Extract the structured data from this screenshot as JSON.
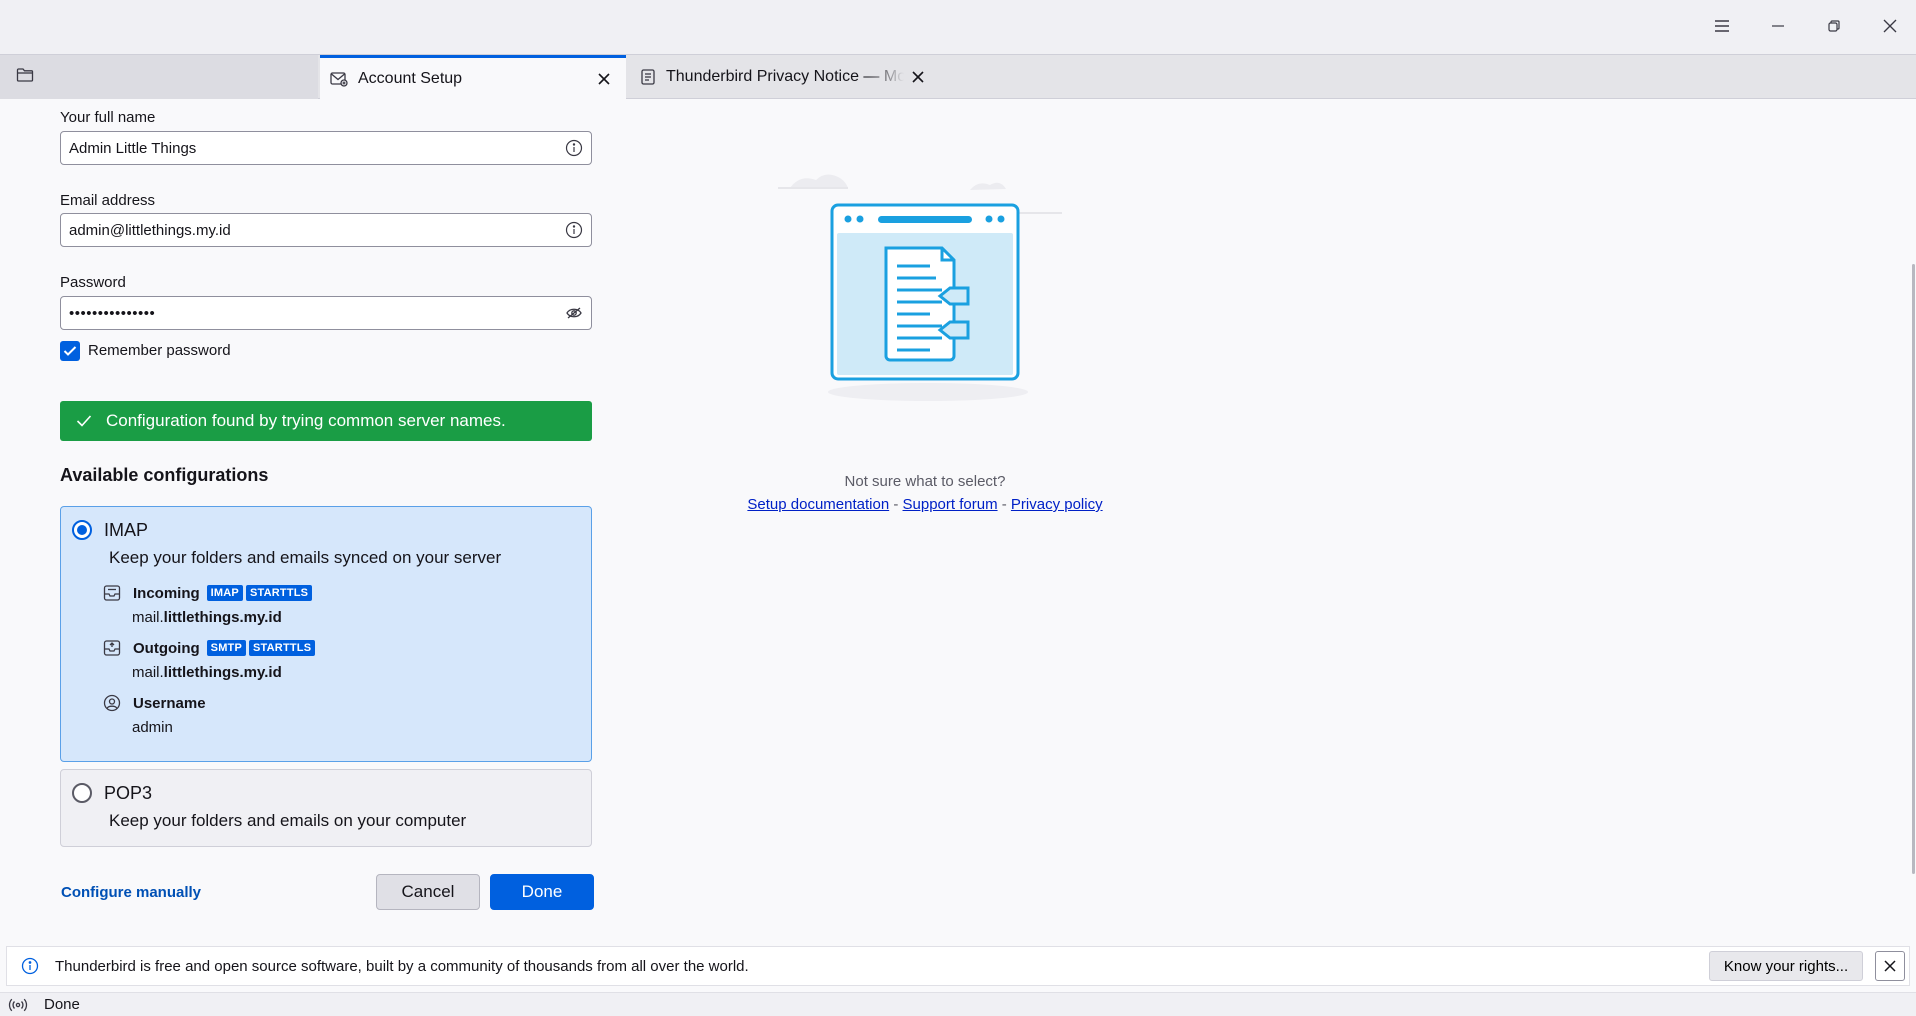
{
  "window": {
    "menu_icon": "hamburger-menu-icon",
    "minimize_icon": "minimize-icon",
    "restore_icon": "restore-icon",
    "close_icon": "close-icon"
  },
  "tabs": [
    {
      "label": "",
      "icon": "folder-icon",
      "active": false
    },
    {
      "label": "Account Setup",
      "icon": "mail-setup-icon",
      "active": true
    },
    {
      "label": "Thunderbird Privacy Notice — Mozilla",
      "icon": "document-icon",
      "active": false
    }
  ],
  "form": {
    "full_name_label": "Your full name",
    "full_name_value": "Admin Little Things",
    "email_label": "Email address",
    "email_value": "admin@littlethings.my.id",
    "password_label": "Password",
    "password_value": "•••••••••••••••",
    "remember_label": "Remember password",
    "remember_checked": true
  },
  "banner": {
    "text": "Configuration found by trying common server names.",
    "color": "#1a9d45"
  },
  "configs": {
    "title": "Available configurations",
    "imap": {
      "name": "IMAP",
      "description": "Keep your folders and emails synced on your server",
      "incoming_label": "Incoming",
      "incoming_badges": [
        "IMAP",
        "STARTTLS"
      ],
      "incoming_host_prefix": "mail.",
      "incoming_host_domain": "littlethings.my.id",
      "outgoing_label": "Outgoing",
      "outgoing_badges": [
        "SMTP",
        "STARTTLS"
      ],
      "outgoing_host_prefix": "mail.",
      "outgoing_host_domain": "littlethings.my.id",
      "username_label": "Username",
      "username_value": "admin",
      "selected": true
    },
    "pop3": {
      "name": "POP3",
      "description": "Keep your folders and emails on your computer",
      "selected": false
    }
  },
  "actions": {
    "configure_manually": "Configure manually",
    "cancel": "Cancel",
    "done": "Done"
  },
  "help": {
    "question": "Not sure what to select?",
    "setup_doc": "Setup documentation",
    "separator": " - ",
    "support_forum": "Support forum",
    "privacy_policy": "Privacy policy"
  },
  "notification": {
    "text": "Thunderbird is free and open source software, built by a community of thousands from all over the world.",
    "button": "Know your rights..."
  },
  "status": {
    "text": "Done"
  },
  "colors": {
    "accent": "#0060df",
    "success": "#1a9d45",
    "selected_card": "#d6e7fb",
    "illustration_blue": "#1aa0e0"
  }
}
